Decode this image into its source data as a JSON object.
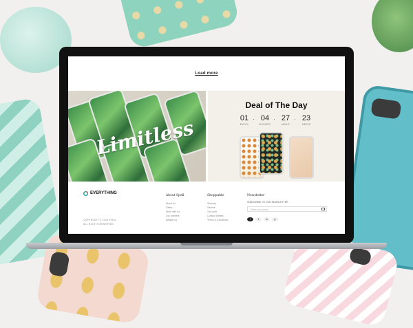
{
  "page": {
    "load_more": "Load more"
  },
  "banner": {
    "script_text": "Limitless"
  },
  "deal": {
    "title": "Deal of The Day",
    "countdown": [
      {
        "value": "01",
        "label": "DAYS"
      },
      {
        "value": "04",
        "label": "HOURS"
      },
      {
        "value": "27",
        "label": "MINS"
      },
      {
        "value": "23",
        "label": "SECS"
      }
    ]
  },
  "footer": {
    "brand": "EVERYTHING",
    "copyright_lines": [
      "COPYRIGHT © 2019 PIXEL",
      "ALL RIGHTS RESERVED"
    ],
    "columns": [
      {
        "heading": "About Spell",
        "links": [
          "About us",
          "Offers",
          "Work with us",
          "Our partners",
          "Affiliate us"
        ]
      },
      {
        "heading": "Shoppable",
        "links": [
          "Sitemap",
          "Service",
          "Get code",
          "Contact Details",
          "Terms & Conditions"
        ]
      }
    ],
    "newsletter": {
      "heading": "Newsletter",
      "text": "SUBSCRIBE TO OUR NEWSLETTER",
      "placeholder": "Enter your email"
    },
    "social": [
      "f",
      "t",
      "in",
      "p"
    ]
  },
  "colors": {
    "laptop_bezel": "#111111",
    "deal_bg": "#f3efe9",
    "mint": "#8ed3bd",
    "teal": "#62bfc9"
  }
}
